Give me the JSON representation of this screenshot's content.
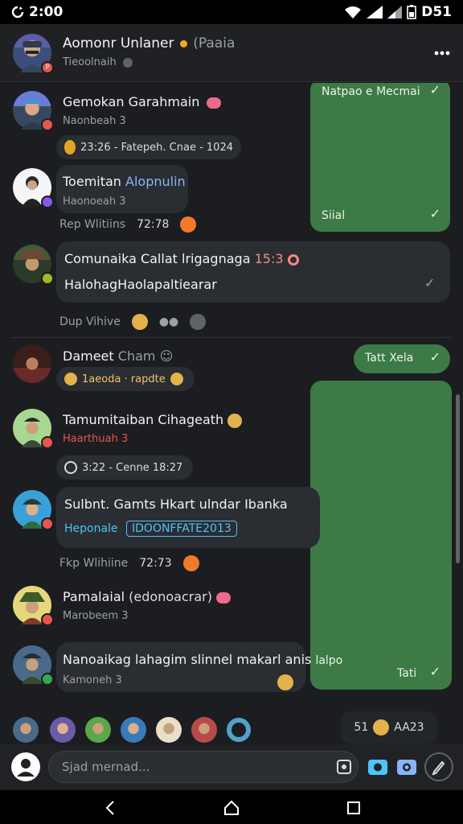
{
  "status_bar": {
    "time": "2:00",
    "right_text": "D51"
  },
  "header": {
    "title": "Aomonr Unlaner",
    "title_extra": "(Paaia",
    "subtitle": "Tieoolnaih",
    "menu_icon": "more-vertical-icon"
  },
  "chats": [
    {
      "name": "Gemokan Garahmain",
      "sub": "Naonbeah 3",
      "pill": "23:26 - Fatepeh. Cnae - 1024"
    },
    {
      "name": "Toemitan",
      "name_extra": "Alopnulin",
      "sub": "Haonoeah 3",
      "meta_a": "Rep Wlitiins",
      "meta_b": "72:78"
    },
    {
      "name": "Comunaika Callat",
      "name_mid": "lrigagnaga",
      "name_num": "15:3",
      "line2": "HalohagHaolapaltiearar",
      "meta_a": "Dup Vihive"
    },
    {
      "name": "Dameet",
      "name_extra": "Cham",
      "pill": "1aeoda · rapdte"
    },
    {
      "name": "Tamumitaiban Cihageath",
      "sub": "Haarthuah 3",
      "pill": "3:22 - Cenne 18:27"
    },
    {
      "name": "Sulbnt. Gamts Hkart ulndar Ibanka",
      "tag1": "Heponale",
      "tag2": "IDOONFFATE2013",
      "meta_a": "Fkp Wlihiine",
      "meta_b": "72:73"
    },
    {
      "name": "Pamalaial",
      "name_extra": "(edonoacrar)",
      "sub": "Marobeem 3"
    },
    {
      "name": "Nanoaikag lahagim slinnel makarl anis",
      "name_extra": "lalpo",
      "sub": "Kamoneh 3"
    }
  ],
  "outgoing": [
    {
      "text": "Natpao e Mecmai"
    },
    {
      "text": "Siial"
    },
    {
      "text": "Tatt Xela"
    },
    {
      "text": "Tati"
    }
  ],
  "recent": {
    "pill_num": "51",
    "pill_text": "AA23"
  },
  "composer": {
    "placeholder": "Sjad mernad..."
  },
  "colors": {
    "accent_green": "#3d7a45",
    "background": "#1b1d21",
    "bubble": "#2a2d32",
    "ring_blue": "#4fa3c7"
  }
}
